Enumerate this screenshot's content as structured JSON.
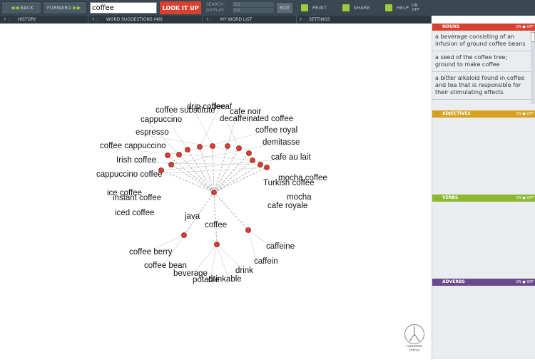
{
  "toolbar": {
    "back": "BACK",
    "forward": "FORWARD",
    "search_value": "coffee",
    "lookup": "LOOK IT UP",
    "search_label": "SEARCH:",
    "display_label": "DISPLAY:",
    "search_lang": "EN",
    "display_lang": "EN",
    "edit": "EDIT",
    "print": "PRINT",
    "share": "SHARE",
    "help": "HELP",
    "on": "ON",
    "off": "OFF"
  },
  "tabs": [
    {
      "label": "HISTORY"
    },
    {
      "label": "WORD SUGGESTIONS (48)"
    },
    {
      "label": "MY WORD LIST"
    },
    {
      "label": "SETTINGS"
    }
  ],
  "sidebar": {
    "nouns": {
      "title": "NOUNS",
      "color": "#d84030",
      "defs": [
        "a beverage consisting of an infusion of ground coffee beans",
        "a seed of the coffee tree; ground to make coffee",
        "a bitter alkaloid found in coffee and tea that is responsible for their stimulating effects"
      ]
    },
    "adjectives": {
      "title": "ADJECTIVES",
      "color": "#d8a020"
    },
    "verbs": {
      "title": "VERBS",
      "color": "#8cb830"
    },
    "adverbs": {
      "title": "ADVERBS",
      "color": "#6a4a8a"
    },
    "on": "ON",
    "off": "OFF"
  },
  "graph": {
    "center_word": "coffee",
    "edge_color": "#b0b0b0",
    "node_color": "#d84030",
    "labels": [
      {
        "text": "drip coffee"
      },
      {
        "text": "decaf"
      },
      {
        "text": "coffee substitute"
      },
      {
        "text": "cafe noir"
      },
      {
        "text": "cappuccino"
      },
      {
        "text": "decaffeinated coffee"
      },
      {
        "text": "coffee royal"
      },
      {
        "text": "espresso"
      },
      {
        "text": "demitasse"
      },
      {
        "text": "coffee cappuccino"
      },
      {
        "text": "cafe au lait"
      },
      {
        "text": "Irish coffee"
      },
      {
        "text": "cappuccino coffee"
      },
      {
        "text": "mocha coffee"
      },
      {
        "text": "Turkish coffee"
      },
      {
        "text": "ice coffee"
      },
      {
        "text": "instant coffee"
      },
      {
        "text": "mocha"
      },
      {
        "text": "cafe royale"
      },
      {
        "text": "iced coffee"
      },
      {
        "text": "java"
      },
      {
        "text": "coffee"
      },
      {
        "text": "caffeine"
      },
      {
        "text": "coffee berry"
      },
      {
        "text": "caffein"
      },
      {
        "text": "coffee bean"
      },
      {
        "text": "drink"
      },
      {
        "text": "beverage"
      },
      {
        "text": "drinkable"
      },
      {
        "text": "potable"
      }
    ]
  },
  "narrower": {
    "line1": "narrower",
    "line2": "terms"
  }
}
